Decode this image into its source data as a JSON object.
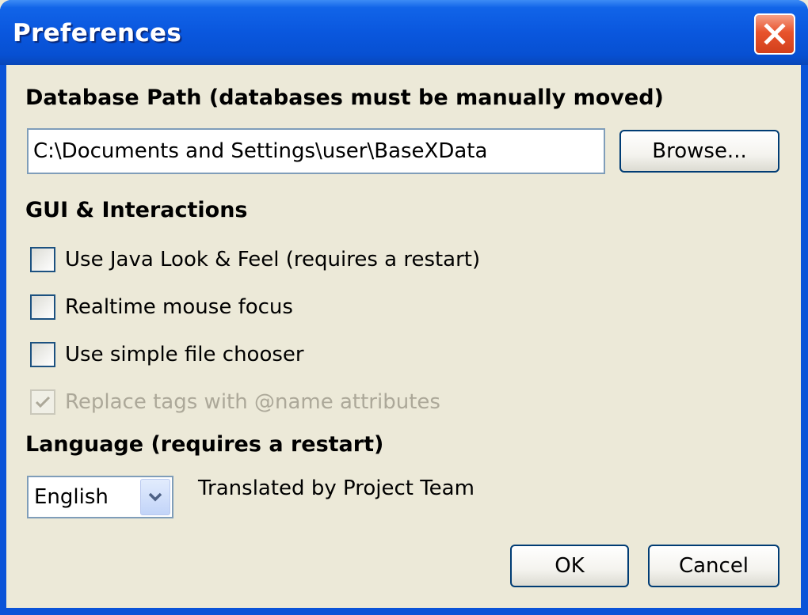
{
  "window": {
    "title": "Preferences"
  },
  "database": {
    "section_label": "Database Path (databases must be manually moved)",
    "path_value": "C:\\Documents and Settings\\user\\BaseXData",
    "browse_label": "Browse..."
  },
  "gui": {
    "section_label": "GUI & Interactions",
    "options": [
      {
        "label": "Use Java Look & Feel (requires a restart)",
        "checked": false,
        "enabled": true
      },
      {
        "label": "Realtime mouse focus",
        "checked": false,
        "enabled": true
      },
      {
        "label": "Use simple file chooser",
        "checked": false,
        "enabled": true
      },
      {
        "label": "Replace tags with @name attributes",
        "checked": true,
        "enabled": false
      }
    ]
  },
  "language": {
    "section_label": "Language (requires a restart)",
    "selected": "English",
    "translator": "Translated by Project Team"
  },
  "buttons": {
    "ok_label": "OK",
    "cancel_label": "Cancel"
  },
  "colors": {
    "titlebar": "#0a57de",
    "dialog_bg": "#ece9d8",
    "close_button": "#e8532c",
    "disabled_text": "#aca899"
  },
  "icons": {
    "close": "close-x-icon",
    "check": "checkmark-icon",
    "dropdown": "chevron-down-icon"
  }
}
